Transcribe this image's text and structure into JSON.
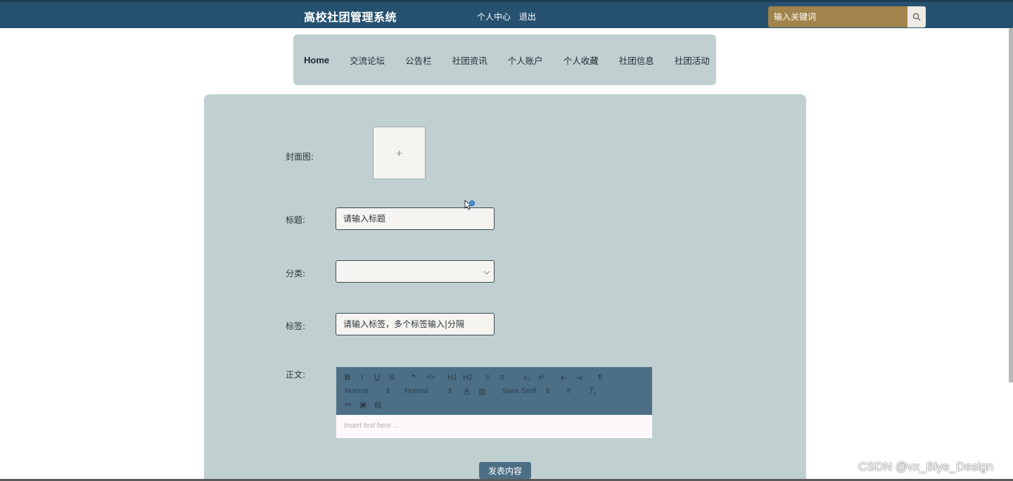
{
  "header": {
    "site_title": "高校社团管理系统",
    "links": [
      "个人中心",
      "退出"
    ],
    "search": {
      "placeholder": "输入关键词",
      "icon": "search-icon"
    }
  },
  "nav": {
    "items": [
      "Home",
      "交流论坛",
      "公告栏",
      "社团资讯",
      "个人账户",
      "个人收藏",
      "社团信息",
      "社团活动"
    ]
  },
  "form": {
    "cover": {
      "label": "封面图:",
      "upload_symbol": "+"
    },
    "title": {
      "label": "标题:",
      "placeholder": "请输入标题"
    },
    "category": {
      "label": "分类:",
      "value": ""
    },
    "tags": {
      "label": "标签:",
      "placeholder": "请输入标签，多个标签输入|分隔"
    },
    "body": {
      "label": "正文:",
      "toolbar": {
        "row1": [
          "B",
          "I",
          "U",
          "S",
          "❞",
          "<>",
          "H1",
          "H2",
          "≡",
          "≡",
          "x₂",
          "x²",
          "⇤",
          "⇥",
          "¶"
        ],
        "size_select": "Normal",
        "header_select": "Normal",
        "font_select": "Sans Serif"
      },
      "placeholder": "Insert text here ..."
    },
    "submit_label": "发表内容"
  },
  "watermark": "CSDN @vx_Biye_Design",
  "colors": {
    "header_bg": "#265270",
    "panel_bg": "#c0d0d0",
    "search_bg": "#a2834c",
    "toolbar_bg": "#4c6f86"
  }
}
